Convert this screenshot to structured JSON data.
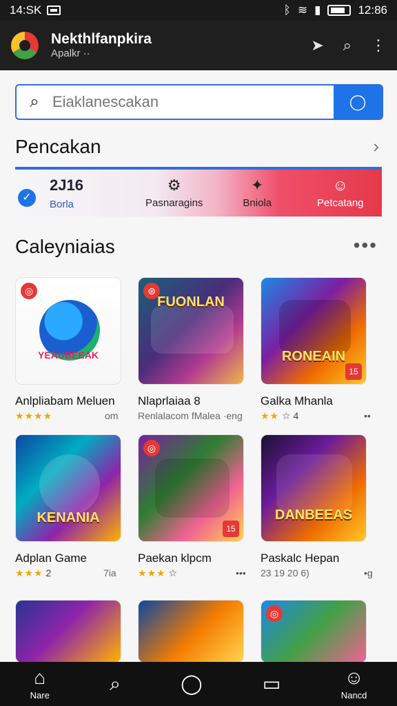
{
  "status": {
    "time": "14:SK",
    "clock": "12:86"
  },
  "app": {
    "title": "Nekthlfanpkira",
    "subtitle": "Apalkr ··"
  },
  "search": {
    "placeholder": "Eiaklanescakan"
  },
  "promo": {
    "title": "Pencakan",
    "items": [
      {
        "value": "2J16",
        "label": "Borla"
      },
      {
        "label": "Pasnaragins"
      },
      {
        "label": "Bniola"
      },
      {
        "label": "Petcatang"
      }
    ]
  },
  "categories": {
    "title": "Caleyniaias",
    "games": [
      {
        "name": "Anlpliabam Meluen",
        "rating_stars": "★★★★",
        "meta": "om"
      },
      {
        "name": "Nlaprlaiaa 8",
        "rating_stars": "",
        "meta": "Renlalacom fMalea ·eng"
      },
      {
        "name": "Galka Mhanla",
        "rating_stars": "★★",
        "meta": "☆ 4",
        "meta2": "••"
      },
      {
        "name": "Adplan Game",
        "rating_stars": "★★★",
        "meta": "2",
        "meta2": "7ia"
      },
      {
        "name": "Paekan klpcm",
        "rating_stars": "★★★",
        "meta": "☆",
        "meta2": "•••"
      },
      {
        "name": "Paskalc Hepan",
        "rating_stars": "",
        "meta": "23 19 20 6)",
        "meta2": "•g"
      }
    ],
    "tile_texts": [
      "YEAUBEEAK",
      "FUONLAN",
      "RONEAIN",
      "KENANIA",
      "",
      "DANBEEAS"
    ]
  },
  "bottom_nav": {
    "items": [
      {
        "label": "Nare"
      },
      {
        "label": ""
      },
      {
        "label": ""
      },
      {
        "label": ""
      },
      {
        "label": "Nancd"
      }
    ]
  }
}
